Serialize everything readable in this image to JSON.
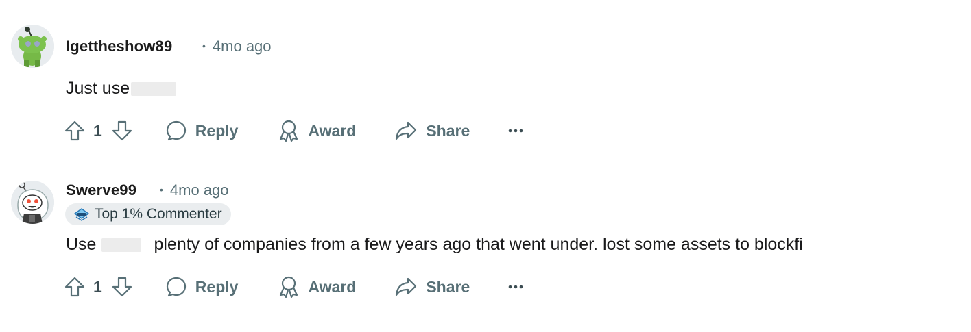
{
  "comments": [
    {
      "author": "Igettheshow89",
      "age": "4mo ago",
      "flair": null,
      "text_before": "Just use",
      "text_after": "",
      "votes": "1",
      "avatar_icon": "snoo-green-avatar-icon"
    },
    {
      "author": "Swerve99",
      "age": "4mo ago",
      "flair": "Top 1% Commenter",
      "text_before": "Use",
      "text_after": "plenty of companies from a few years ago that went under. lost some assets to blockfi",
      "votes": "1",
      "avatar_icon": "snoo-parka-avatar-icon"
    }
  ],
  "actions": {
    "reply": "Reply",
    "award": "Award",
    "share": "Share"
  },
  "separator": "•",
  "colors": {
    "meta": "#576f76",
    "flair_bg": "#eaedef",
    "text": "#1a1a1b"
  }
}
